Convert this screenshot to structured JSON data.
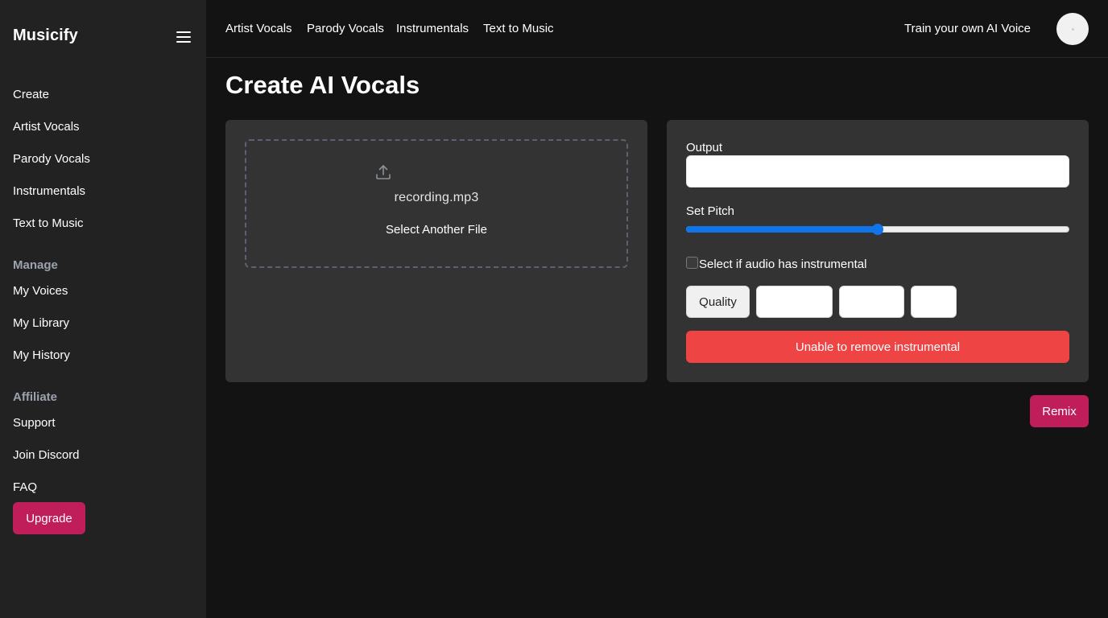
{
  "brand": "Musicify",
  "sidebar": {
    "create_items": [
      "Create",
      "Artist Vocals",
      "Parody Vocals",
      "Instrumentals",
      "Text to Music"
    ],
    "manage_heading": "Manage",
    "manage_items": [
      "My Voices",
      "My Library",
      "My History"
    ],
    "affiliate_heading": "Affiliate",
    "affiliate_items": [
      "Support",
      "Join Discord",
      "FAQ"
    ],
    "upgrade_label": "Upgrade"
  },
  "topbar": {
    "links": [
      "Artist Vocals",
      "Parody Vocals",
      "Instrumentals",
      "Text to Music"
    ],
    "train_label": "Train your own AI Voice"
  },
  "page": {
    "title": "Create AI Vocals"
  },
  "upload": {
    "file_name": "recording.mp3",
    "select_another": "Select Another File"
  },
  "settings": {
    "output_label": "Output",
    "output_value": "",
    "pitch_label": "Set Pitch",
    "pitch_fraction": 0.5,
    "instrumental_checkbox_label": "Select if audio has instrumental",
    "instrumental_checked": false,
    "quality_label": "Quality",
    "quality_options": [
      "",
      "",
      ""
    ],
    "instrumental_warning": "Unable to remove instrumental"
  },
  "actions": {
    "remix_label": "Remix"
  },
  "colors": {
    "accent": "#c01d5b",
    "danger": "#ef4444",
    "slider": "#0f75e8",
    "background": "#131313",
    "sidebar": "#222222",
    "panel": "#333333"
  }
}
